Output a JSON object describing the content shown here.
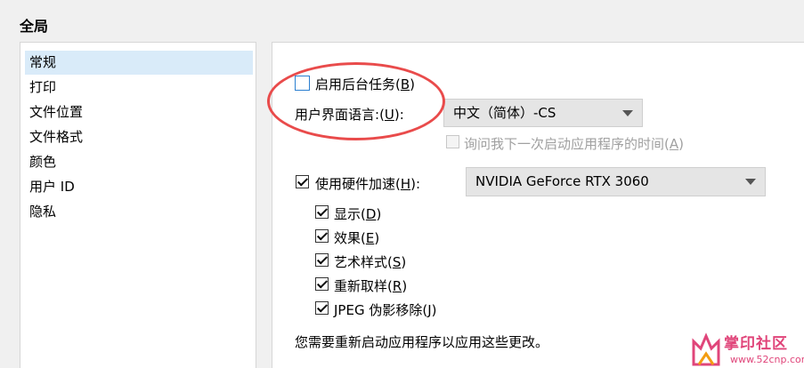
{
  "title": "全局",
  "sidebar": {
    "items": [
      {
        "label": "常规",
        "selected": true
      },
      {
        "label": "打印"
      },
      {
        "label": "文件位置"
      },
      {
        "label": "文件格式"
      },
      {
        "label": "颜色"
      },
      {
        "label": "用户 ID"
      },
      {
        "label": "隐私"
      }
    ]
  },
  "general": {
    "background_tasks": {
      "label": "启用后台任务",
      "shortcut_paren_open": "(",
      "key": "B",
      "shortcut_paren_close": ")",
      "checked": false
    },
    "ui_language": {
      "label": "用户界面语言:",
      "key_open": "(",
      "key": "U",
      "key_close": "):",
      "value": "中文（简体）-CS"
    },
    "ask_next_launch": {
      "label": "询问我下一次启动应用程序的时间",
      "key_open": "(",
      "key": "A",
      "key_close": ")",
      "checked": false,
      "enabled": false
    },
    "hw_accel": {
      "label": "使用硬件加速",
      "key_open": "(",
      "key": "H",
      "key_close": "):",
      "checked": true,
      "gpu": "NVIDIA GeForce RTX 3060"
    },
    "sub_options": [
      {
        "label": "显示",
        "key": "D",
        "checked": true
      },
      {
        "label": "效果",
        "key": "E",
        "checked": true
      },
      {
        "label": "艺术样式",
        "key": "S",
        "checked": true
      },
      {
        "label": "重新取样",
        "key": "R",
        "checked": true
      },
      {
        "label": "JPEG 伪影移除",
        "key": "J",
        "checked": true
      }
    ],
    "restart_notice": "您需要重新启动应用程序以应用这些更改。"
  },
  "watermark": {
    "text": "掌印社区",
    "url": "www.52cnp.com"
  },
  "colors": {
    "annotation": "#e94b4b",
    "selection": "#d9ebf9",
    "watermark": "#e0457a"
  }
}
